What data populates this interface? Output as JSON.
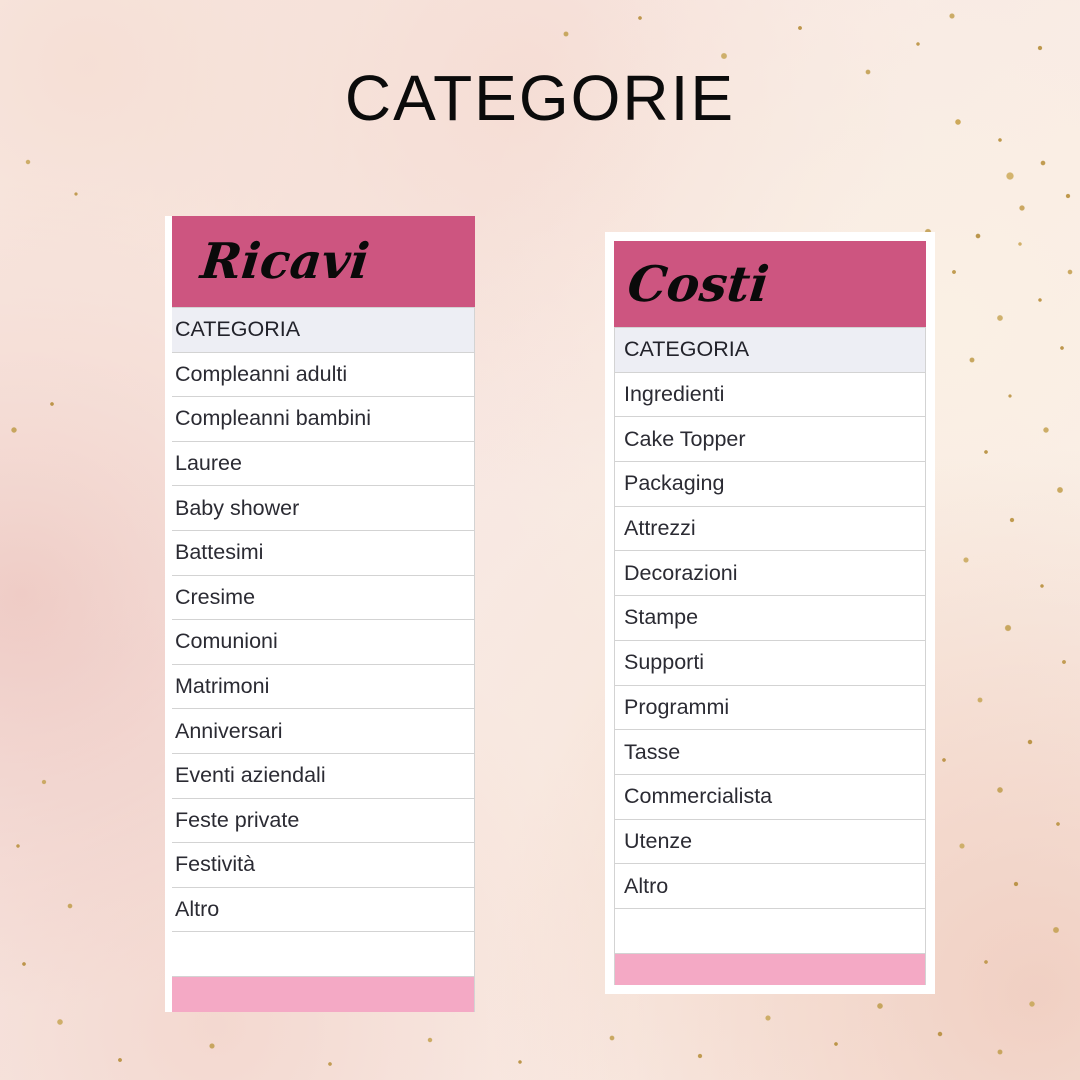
{
  "page": {
    "title": "CATEGORIE",
    "background_style": "pink-marble-gold-flecks",
    "colors": {
      "banner_pink": "#cd5580",
      "footer_pink": "#f4a9c5",
      "header_row": "#edeef4",
      "grid_line": "#d3d3d3",
      "cell_text": "#2b2b33",
      "title_text": "#0b0b0b",
      "card_white": "#ffffff"
    }
  },
  "tables": [
    {
      "id": "ricavi",
      "banner_label": "Ricavi",
      "column_header": "CATEGORIA",
      "rows": [
        "Compleanni adulti",
        "Compleanni bambini",
        "Lauree",
        "Baby shower",
        "Battesimi",
        "Cresime",
        "Comunioni",
        "Matrimoni",
        "Anniversari",
        "Eventi aziendali",
        "Feste private",
        "Festività",
        "Altro"
      ],
      "blank_row": "",
      "footer_row": ""
    },
    {
      "id": "costi",
      "banner_label": "Costi",
      "column_header": "CATEGORIA",
      "rows": [
        "Ingredienti",
        "Cake Topper",
        "Packaging",
        "Attrezzi",
        "Decorazioni",
        "Stampe",
        "Supporti",
        "Programmi",
        "Tasse",
        "Commercialista",
        "Utenze",
        "Altro"
      ],
      "blank_row": "",
      "footer_row": ""
    }
  ]
}
